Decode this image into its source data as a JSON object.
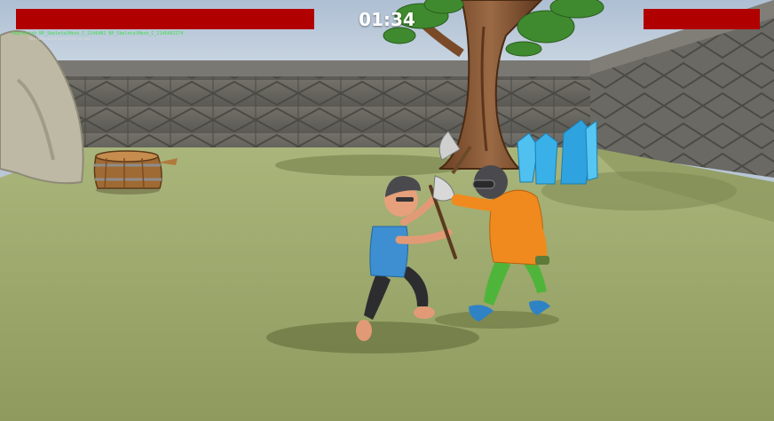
{
  "hud": {
    "timer": "01:34",
    "player_health": 1.0,
    "enemy_health": 1.0,
    "health_color": "#b00000",
    "debug_line_1": "Replenish BP_SkeletalMesh_C_2146482 BP_SkeletalMesh_C_2146482274",
    "debug_line_2": "ThirdPersonCharacter 0 sec"
  },
  "scene": {
    "sky_color": "#c9d6e4",
    "ground_color": "#9aa669",
    "wall_color": "#67665f",
    "player_shirt_color": "#3d8fd1",
    "enemy_hoodie_color": "#f08a1e",
    "enemy_pants_color": "#4fb53a",
    "crystal_color": "#3ab0e8",
    "icons": [
      "tree-icon",
      "barrel-icon",
      "rock-icon",
      "crystal-icon",
      "axe-icon"
    ]
  }
}
